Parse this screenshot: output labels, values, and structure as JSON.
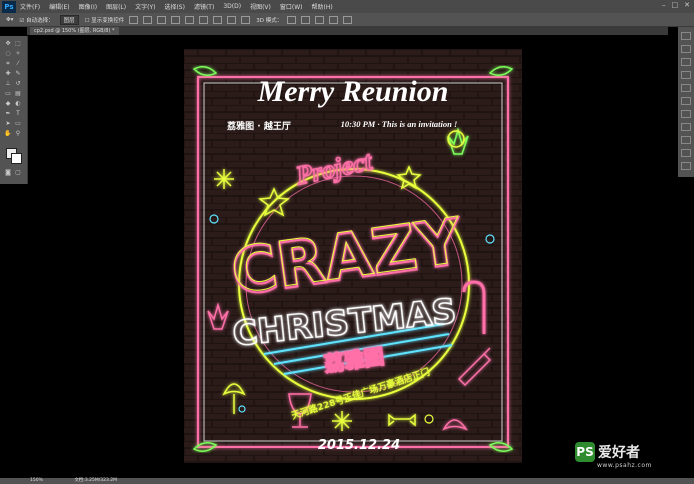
{
  "app": {
    "logo": "Ps"
  },
  "menu": [
    "文件(F)",
    "编辑(E)",
    "图像(I)",
    "图层(L)",
    "文字(Y)",
    "选择(S)",
    "滤镜(T)",
    "3D(D)",
    "视图(V)",
    "窗口(W)",
    "帮助(H)"
  ],
  "options": {
    "auto_select": "自动选择：",
    "layer_select": "图层",
    "show_transform": "显示变换控件",
    "mode_3d": "3D 模式："
  },
  "document": {
    "tab_title": "cp2.psd @ 150% (图层, RGB/8) *",
    "zoom": "150%",
    "doc_size": "文档:3.25M/323.2M"
  },
  "poster": {
    "title": "Merry Reunion",
    "subtitle_cn": "荔雅图 · 越王厅",
    "time_line": "10:30 PM · This is an invitation !",
    "project": "Project",
    "crazy": "CRAZY",
    "christmas": "CHRISTMAS",
    "brand_cn": "荔雅图",
    "address_cn": "天河路228号正佳广场万豪酒店正门",
    "date": "2015.12.24"
  },
  "watermark": {
    "badge": "PS",
    "text": "爱好者",
    "url": "www.psahz.com"
  },
  "colors": {
    "neon_pink": "#ff6fa8",
    "neon_yellow": "#e8ff3c",
    "neon_green": "#7cff5a",
    "neon_cyan": "#5fe3ff",
    "white": "#ffffff",
    "brick": "#2a1a1a"
  }
}
